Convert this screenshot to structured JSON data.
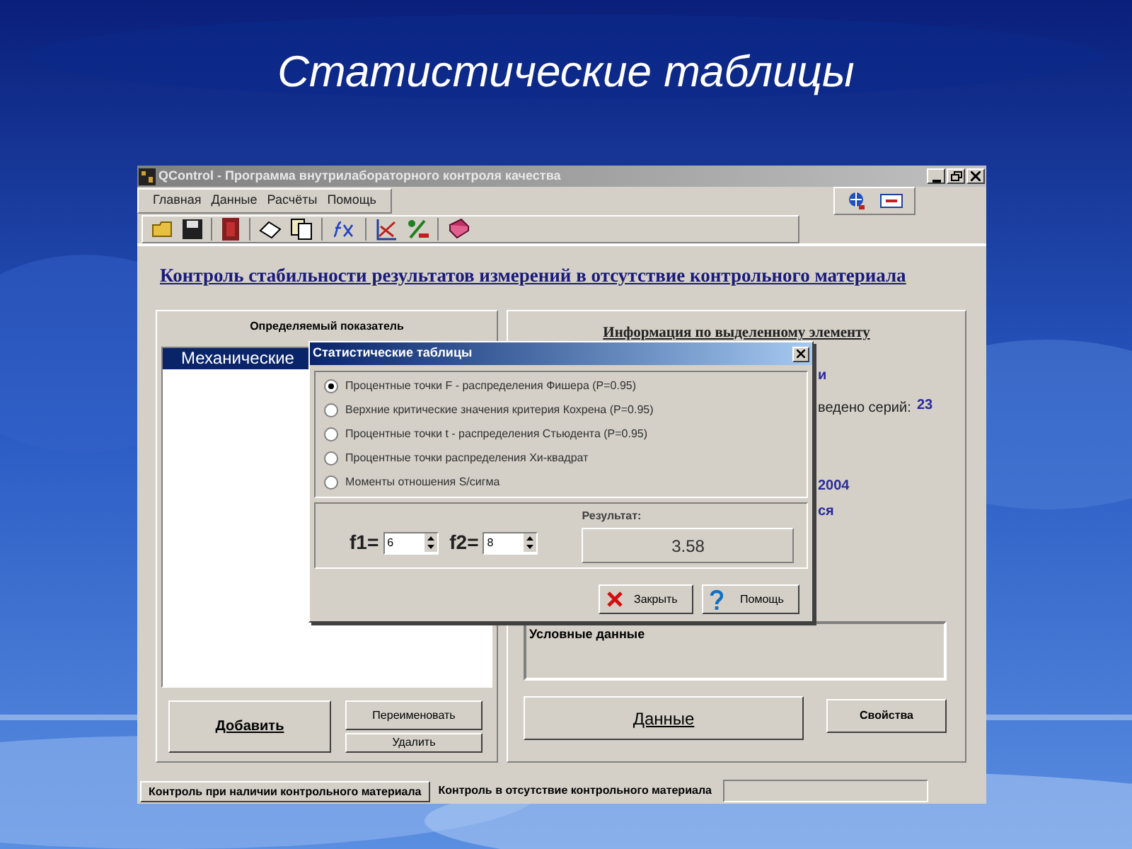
{
  "slide_title": "Статистические таблицы",
  "window": {
    "title": "QControl - Программа внутрилабораторного контроля качества"
  },
  "menu": [
    "Главная",
    "Данные",
    "Расчёты",
    "Помощь"
  ],
  "page_heading": "Контроль стабильности результатов измерений в отсутствие контрольного материала",
  "left_panel": {
    "title": "Определяемый показатель",
    "items": [
      {
        "label": "Механические",
        "selected": true
      }
    ],
    "buttons": [
      "Добавить",
      "Переименовать",
      "Удалить"
    ]
  },
  "right_panel": {
    "title": "Информация по выделенному элементу",
    "fragments": [
      {
        "text": "и",
        "kind": "value"
      },
      {
        "text": "ведено серий:",
        "kind": "label"
      },
      {
        "text": "23",
        "kind": "value"
      },
      {
        "text": "2004",
        "kind": "value"
      },
      {
        "text": "ся",
        "kind": "value"
      }
    ],
    "notes_box": "Условные данные",
    "buttons": [
      "Данные",
      "Свойства"
    ]
  },
  "tabs": [
    {
      "label": "Контроль при наличии контрольного материала",
      "selected": false
    },
    {
      "label": "Контроль в отсутствие контрольного материала",
      "selected": true
    }
  ],
  "dialog": {
    "title": "Статистические таблицы",
    "options": [
      {
        "label": "Процентные точки F - распределения Фишера (P=0.95)",
        "selected": true
      },
      {
        "label": "Верхние критические значения критерия Кохрена (P=0.95)",
        "selected": false
      },
      {
        "label": "Процентные точки t - распределения Стьюдента (P=0.95)",
        "selected": false
      },
      {
        "label": "Процентные точки распределения Хи-квадрат",
        "selected": false
      },
      {
        "label": "Моменты отношения S/сигма",
        "selected": false
      }
    ],
    "fields": [
      {
        "label": "f1=",
        "value": "6"
      },
      {
        "label": "f2=",
        "value": "8"
      }
    ],
    "result_label": "Результат:",
    "result": "3.58",
    "buttons": [
      "Закрыть",
      "Помощь"
    ]
  }
}
